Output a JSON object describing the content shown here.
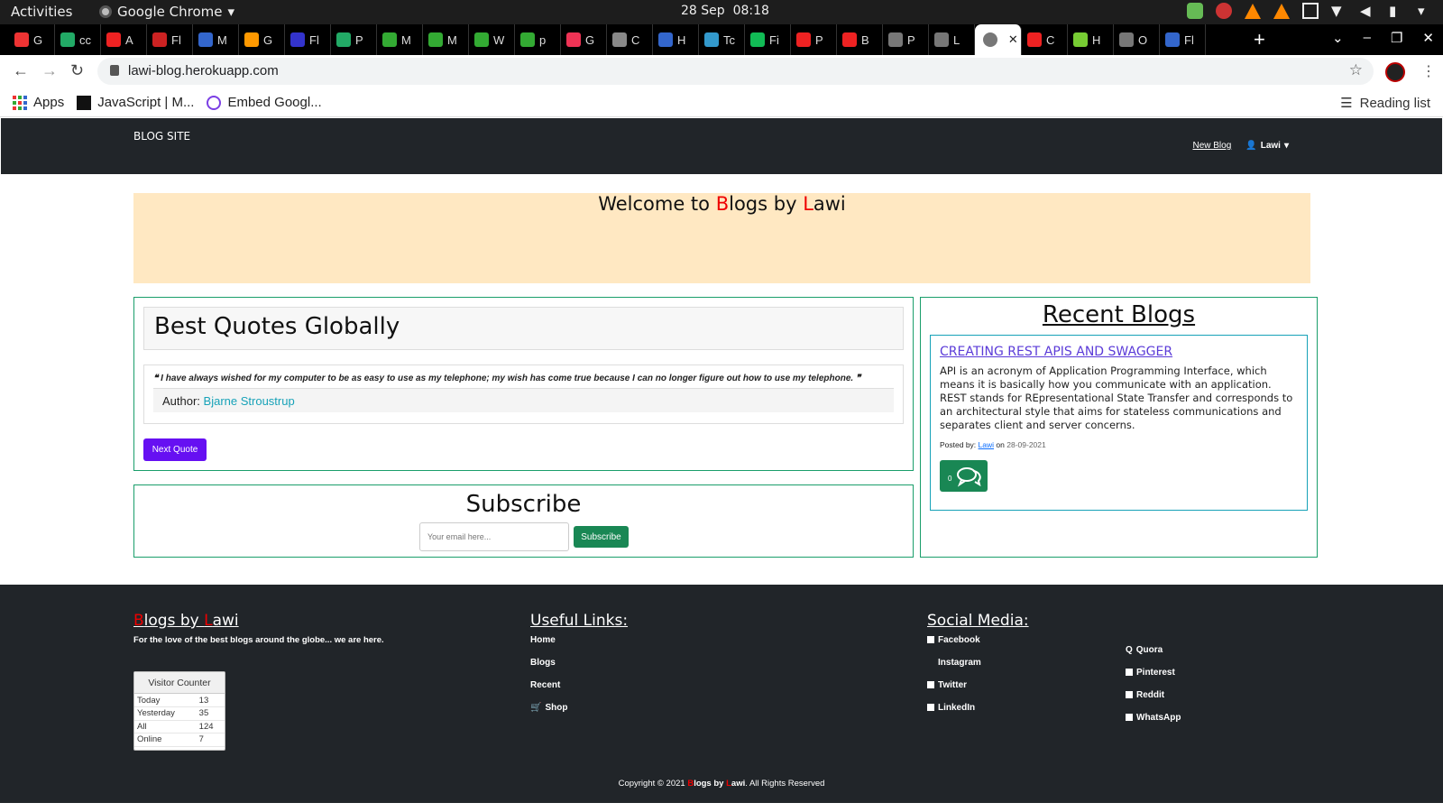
{
  "os": {
    "activities": "Activities",
    "app_name": "Google Chrome",
    "date": "28 Sep",
    "time": "08:18"
  },
  "browser": {
    "tabs": [
      "G",
      "cc",
      "A",
      "Fl",
      "M",
      "G",
      "Fl",
      "P",
      "M",
      "M",
      "W",
      "p",
      "G",
      "C",
      "H",
      "Tc",
      "Fi",
      "P",
      "B",
      "P",
      "L",
      "h",
      "C",
      "H",
      "O",
      "Fl"
    ],
    "tab_colors": [
      "#e33",
      "#2a6",
      "#e22",
      "#c22",
      "#36c",
      "#f90",
      "#33c",
      "#2a6",
      "#3a3",
      "#3a3",
      "#3a3",
      "#3a3",
      "#e35",
      "#888",
      "#36c",
      "#39c",
      "#1b5",
      "#e22",
      "#e22",
      "#777",
      "#777",
      "#777",
      "#e22",
      "#7c3",
      "#777",
      "#36c"
    ],
    "url": "lawi-blog.herokuapp.com",
    "bookmarks": [
      "Apps",
      "JavaScript | M...",
      "Embed Googl..."
    ],
    "reading_list": "Reading list"
  },
  "site": {
    "brand": "BLOG SITE",
    "nav_new_blog": "New Blog",
    "user": "Lawi"
  },
  "hero": {
    "welcome_pre": "Welcome to ",
    "b": "B",
    "logs": "logs by ",
    "l": "L",
    "awi": "awi"
  },
  "quotes": {
    "heading": "Best Quotes Globally",
    "quote": "I have always wished for my computer to be as easy to use as my telephone; my wish has come true because I can no longer figure out how to use my telephone.",
    "author_label": "Author:",
    "author": "Bjarne Stroustrup",
    "next_label": "Next Quote"
  },
  "subscribe": {
    "heading": "Subscribe",
    "placeholder": "Your email here...",
    "button": "Subscribe"
  },
  "recent": {
    "heading": "Recent Blogs",
    "post_title": "CREATING REST APIS AND SWAGGER",
    "post_desc": "API is an acronym of Application Programming Interface, which means it is basically how you communicate with an application. REST stands for REpresentational State Transfer and corresponds to an architectural style that aims for stateless communications and separates client and server concerns.",
    "posted_by": "Posted by:",
    "author": "Lawi",
    "on": "on",
    "date": "28-09-2021",
    "comments": "0"
  },
  "footer": {
    "brand_b": "B",
    "brand_logs": "logs by ",
    "brand_l": "L",
    "brand_awi": "awi",
    "tagline": "For the love of the best blogs around the globe... we are here.",
    "counter_title": "Visitor Counter",
    "counter": [
      {
        "label": "Today",
        "value": "13"
      },
      {
        "label": "Yesterday",
        "value": "35"
      },
      {
        "label": "All",
        "value": "124"
      },
      {
        "label": "Online",
        "value": "7"
      }
    ],
    "useful_heading": "Useful Links:",
    "useful_links": [
      "Home",
      "Blogs",
      "Recent",
      "Shop"
    ],
    "social_heading": "Social Media:",
    "social_col1": [
      "Facebook",
      "Instagram",
      "Twitter",
      "LinkedIn"
    ],
    "social_col2": [
      "Quora",
      "Pinterest",
      "Reddit",
      "WhatsApp"
    ],
    "copyright_pre": "Copyright © 2021 ",
    "copyright_post": ". All Rights Reserved"
  }
}
